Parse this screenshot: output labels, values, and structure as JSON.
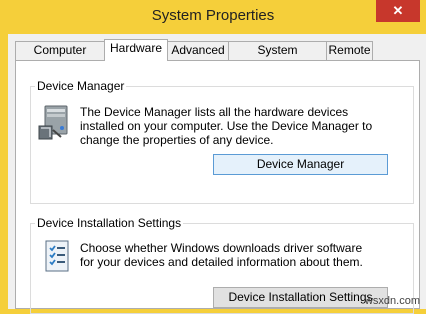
{
  "window": {
    "title": "System Properties",
    "close_glyph": "✕"
  },
  "tabs": [
    {
      "label": "Computer Name",
      "active": false
    },
    {
      "label": "Hardware",
      "active": true
    },
    {
      "label": "Advanced",
      "active": false
    },
    {
      "label": "System Protection",
      "active": false
    },
    {
      "label": "Remote",
      "active": false
    }
  ],
  "device_manager": {
    "group_label": "Device Manager",
    "description": "The Device Manager lists all the hardware devices installed on your computer. Use the Device Manager to change the properties of any device.",
    "button_label": "Device Manager",
    "icon": "device-manager-icon"
  },
  "device_installation": {
    "group_label": "Device Installation Settings",
    "description": "Choose whether Windows downloads driver software for your devices and detailed information about them.",
    "button_label": "Device Installation Settings",
    "icon": "checklist-icon"
  },
  "watermark": "wsxdn.com",
  "colors": {
    "title_bar": "#f5cf3a",
    "close_button": "#c7372c",
    "panel": "#ffffff",
    "focus_border": "#5b9bd5"
  }
}
